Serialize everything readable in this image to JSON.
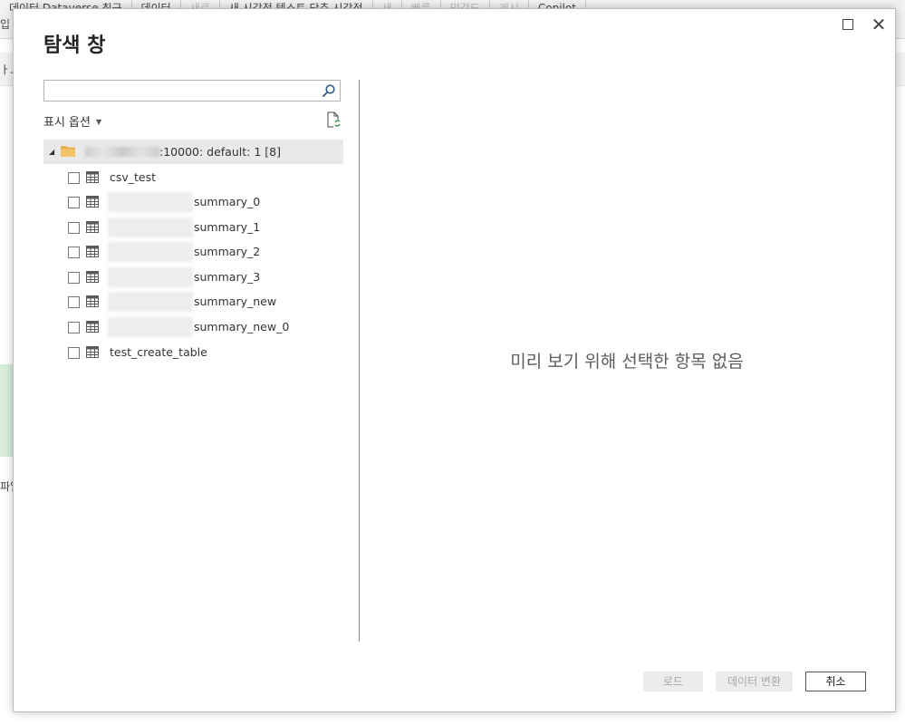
{
  "background": {
    "tabs": [
      {
        "label": "데이터 Dataverse 최근",
        "dim": false
      },
      {
        "label": "데이터",
        "dim": false
      },
      {
        "label": "새로",
        "dim": true
      },
      {
        "label": "새 시각적 텍스트 단추 시각적",
        "dim": false
      },
      {
        "label": "새",
        "dim": true
      },
      {
        "label": "빠른",
        "dim": true
      },
      {
        "label": "민감도",
        "dim": true
      },
      {
        "label": "게시",
        "dim": true
      },
      {
        "label": "Copilot",
        "dim": false
      }
    ],
    "line2": "입",
    "dot_text": "ㅏ.",
    "side_text": "파일"
  },
  "dialog": {
    "title": "탐색 창",
    "window_controls": {
      "maximize": "maximize-icon",
      "close": "close-icon"
    },
    "search": {
      "value": "",
      "placeholder": ""
    },
    "display_options": "표시 옵션",
    "tree": {
      "root_label": ":10000: default: 1 [8]",
      "items": [
        {
          "label": "csv_test",
          "checked": false,
          "obscured_prefix": false
        },
        {
          "label": "summary_0",
          "checked": false,
          "obscured_prefix": true
        },
        {
          "label": "summary_1",
          "checked": false,
          "obscured_prefix": true
        },
        {
          "label": "summary_2",
          "checked": false,
          "obscured_prefix": true
        },
        {
          "label": "summary_3",
          "checked": false,
          "obscured_prefix": true
        },
        {
          "label": "summary_new",
          "checked": false,
          "obscured_prefix": true
        },
        {
          "label": "summary_new_0",
          "checked": false,
          "obscured_prefix": true
        },
        {
          "label": "test_create_table",
          "checked": false,
          "obscured_prefix": false
        }
      ]
    },
    "preview_empty": "미리 보기 위해 선택한 항목 없음",
    "buttons": {
      "load": "로드",
      "transform": "데이터 변환",
      "cancel": "취소"
    },
    "colors": {
      "folder": "#e8b04f",
      "table_icon": "#5a5a5a",
      "selection_bg": "#e9e9e9"
    }
  }
}
